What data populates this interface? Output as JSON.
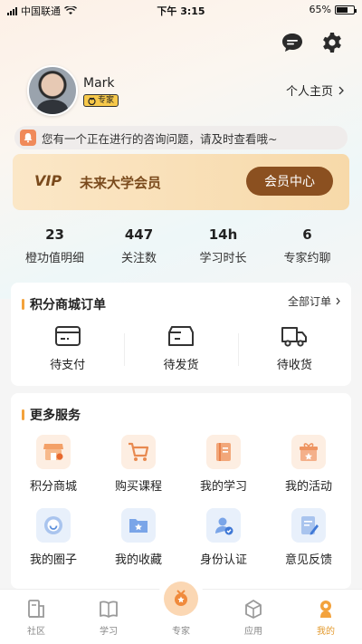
{
  "status_bar": {
    "carrier": "中国联通",
    "time": "下午 3:15",
    "battery": "65%",
    "battery_level": 0.65
  },
  "header": {
    "icons": [
      "message-icon",
      "settings-icon"
    ]
  },
  "profile": {
    "username": "Mark",
    "badge": "专家",
    "homepage_link": "个人主页"
  },
  "notice": {
    "text": "您有一个正在进行的咨询问题，请及时查看哦~"
  },
  "vip": {
    "tag": "VIP",
    "name": "未来大学会员",
    "button": "会员中心"
  },
  "stats": [
    {
      "value": "23",
      "label": "橙功值明细"
    },
    {
      "value": "447",
      "label": "关注数"
    },
    {
      "value": "14h",
      "label": "学习时长"
    },
    {
      "value": "6",
      "label": "专家约聊"
    }
  ],
  "orders": {
    "title": "积分商城订单",
    "more": "全部订单",
    "items": [
      {
        "label": "待支付",
        "icon": "wallet-icon"
      },
      {
        "label": "待发货",
        "icon": "box-icon"
      },
      {
        "label": "待收货",
        "icon": "truck-icon"
      }
    ]
  },
  "services": {
    "title": "更多服务",
    "items": [
      {
        "label": "积分商城",
        "icon": "shop-icon"
      },
      {
        "label": "购买课程",
        "icon": "cart-icon"
      },
      {
        "label": "我的学习",
        "icon": "book-icon"
      },
      {
        "label": "我的活动",
        "icon": "gift-icon"
      },
      {
        "label": "我的圈子",
        "icon": "circle-icon"
      },
      {
        "label": "我的收藏",
        "icon": "folder-star-icon"
      },
      {
        "label": "身份认证",
        "icon": "id-verify-icon"
      },
      {
        "label": "意见反馈",
        "icon": "feedback-icon"
      }
    ]
  },
  "tabbar": {
    "items": [
      {
        "label": "社区",
        "icon": "community-icon"
      },
      {
        "label": "学习",
        "icon": "study-icon"
      },
      {
        "label": "专家",
        "icon": "expert-icon"
      },
      {
        "label": "应用",
        "icon": "apps-icon"
      },
      {
        "label": "我的",
        "icon": "me-icon"
      }
    ],
    "active": "我的"
  },
  "colors": {
    "accent": "#e39a2e",
    "vip_brown": "#8b5020"
  }
}
